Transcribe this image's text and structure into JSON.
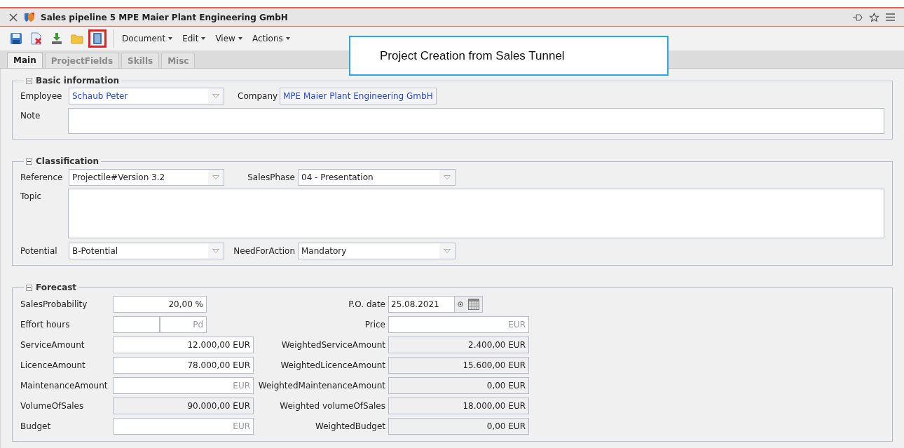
{
  "window": {
    "title": "Sales pipeline 5 MPE Maier Plant Engineering GmbH"
  },
  "toolbar": {
    "icons": [
      {
        "kind": "save",
        "highlighted": false
      },
      {
        "kind": "delete",
        "highlighted": false
      },
      {
        "kind": "download",
        "highlighted": false
      },
      {
        "kind": "folder",
        "highlighted": false
      },
      {
        "kind": "book",
        "highlighted": true
      }
    ],
    "menus": [
      "Document",
      "Edit",
      "View",
      "Actions"
    ]
  },
  "callout": {
    "text": "Project Creation from Sales Tunnel"
  },
  "tabs": [
    {
      "label": "Main",
      "selected": true
    },
    {
      "label": "ProjectFields",
      "selected": false
    },
    {
      "label": "Skills",
      "selected": false
    },
    {
      "label": "Misc",
      "selected": false
    }
  ],
  "basic_information": {
    "title": "Basic information",
    "expanded": true,
    "employee": {
      "label": "Employee",
      "value": "Schaub Peter"
    },
    "company": {
      "label": "Company",
      "value": "MPE Maier Plant Engineering GmbH"
    },
    "note": {
      "label": "Note"
    }
  },
  "classification": {
    "title": "Classification",
    "expanded": true,
    "reference": {
      "label": "Reference",
      "value": "Projectile#Version 3.2"
    },
    "sales_phase": {
      "label": "SalesPhase",
      "value": "04 - Presentation"
    },
    "topic": {
      "label": "Topic"
    },
    "potential": {
      "label": "Potential",
      "value": "B-Potential"
    },
    "need_for_action": {
      "label": "NeedForAction",
      "value": "Mandatory"
    }
  },
  "forecast": {
    "title": "Forecast",
    "expanded": true,
    "rows": [
      {
        "left": {
          "label": "SalesProbability",
          "kind": "short",
          "value": "20,00 %",
          "readonly": false
        },
        "right": {
          "label": "P.O. date",
          "kind": "date",
          "value": "25.08.2021",
          "readonly": false
        }
      },
      {
        "left": {
          "label": "Effort hours",
          "kind": "split",
          "placeholder": "Pd",
          "readonly": false
        },
        "right": {
          "label": "Price",
          "kind": "wide",
          "placeholder": "EUR",
          "readonly": false
        }
      },
      {
        "left": {
          "label": "ServiceAmount",
          "kind": "wide",
          "value": "12.000,00 EUR",
          "readonly": false
        },
        "right": {
          "label": "WeightedServiceAmount",
          "kind": "wide",
          "value": "2.400,00 EUR",
          "readonly": true
        }
      },
      {
        "left": {
          "label": "LicenceAmount",
          "kind": "wide",
          "value": "78.000,00 EUR",
          "readonly": false
        },
        "right": {
          "label": "WeightedLicenceAmount",
          "kind": "wide",
          "value": "15.600,00 EUR",
          "readonly": true
        }
      },
      {
        "left": {
          "label": "MaintenanceAmount",
          "kind": "wide",
          "placeholder": "EUR",
          "readonly": false
        },
        "right": {
          "label": "WeightedMaintenanceAmount",
          "kind": "wide",
          "value": "0,00 EUR",
          "readonly": true
        }
      },
      {
        "left": {
          "label": "VolumeOfSales",
          "kind": "wide",
          "value": "90.000,00 EUR",
          "readonly": true
        },
        "right": {
          "label": "Weighted volumeOfSales",
          "kind": "wide",
          "value": "18.000,00 EUR",
          "readonly": true
        }
      },
      {
        "left": {
          "label": "Budget",
          "kind": "wide",
          "placeholder": "EUR",
          "readonly": false
        },
        "right": {
          "label": "WeightedBudget",
          "kind": "wide",
          "value": "0,00 EUR",
          "readonly": true
        }
      }
    ]
  }
}
